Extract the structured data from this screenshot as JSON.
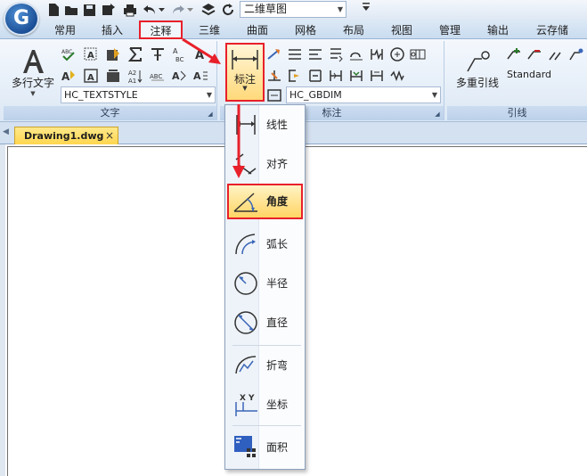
{
  "quick_access": {
    "logo_letter": "G",
    "drawing_name": "二维草图"
  },
  "tabs": [
    {
      "label": "常用"
    },
    {
      "label": "插入"
    },
    {
      "label": "注释"
    },
    {
      "label": "三维"
    },
    {
      "label": "曲面"
    },
    {
      "label": "网格"
    },
    {
      "label": "布局"
    },
    {
      "label": "视图"
    },
    {
      "label": "管理"
    },
    {
      "label": "输出"
    },
    {
      "label": "云存储"
    }
  ],
  "ribbon": {
    "text_panel": {
      "label": "文字",
      "multiline_text": "多行文字",
      "text_style": "HC_TEXTSTYLE"
    },
    "dim_panel": {
      "label": "标注",
      "dimension_button": "标注",
      "dim_style": "HC_GBDIM"
    },
    "leader_panel": {
      "label": "引线",
      "multileader": "多重引线",
      "leader_style": "Standard"
    }
  },
  "document": {
    "tab_label": "Drawing1.dwg",
    "close": "×"
  },
  "dim_menu": {
    "items": [
      {
        "label": "线性"
      },
      {
        "label": "对齐"
      },
      {
        "label": "角度"
      },
      {
        "label": "弧长"
      },
      {
        "label": "半径"
      },
      {
        "label": "直径"
      },
      {
        "label": "折弯"
      },
      {
        "label": "坐标"
      },
      {
        "label": "面积"
      }
    ],
    "selected": "角度"
  },
  "colors": {
    "highlight_border": "#e8202a",
    "selected_fill": "#ffd564",
    "ribbon_bg": "#dce8f5"
  }
}
